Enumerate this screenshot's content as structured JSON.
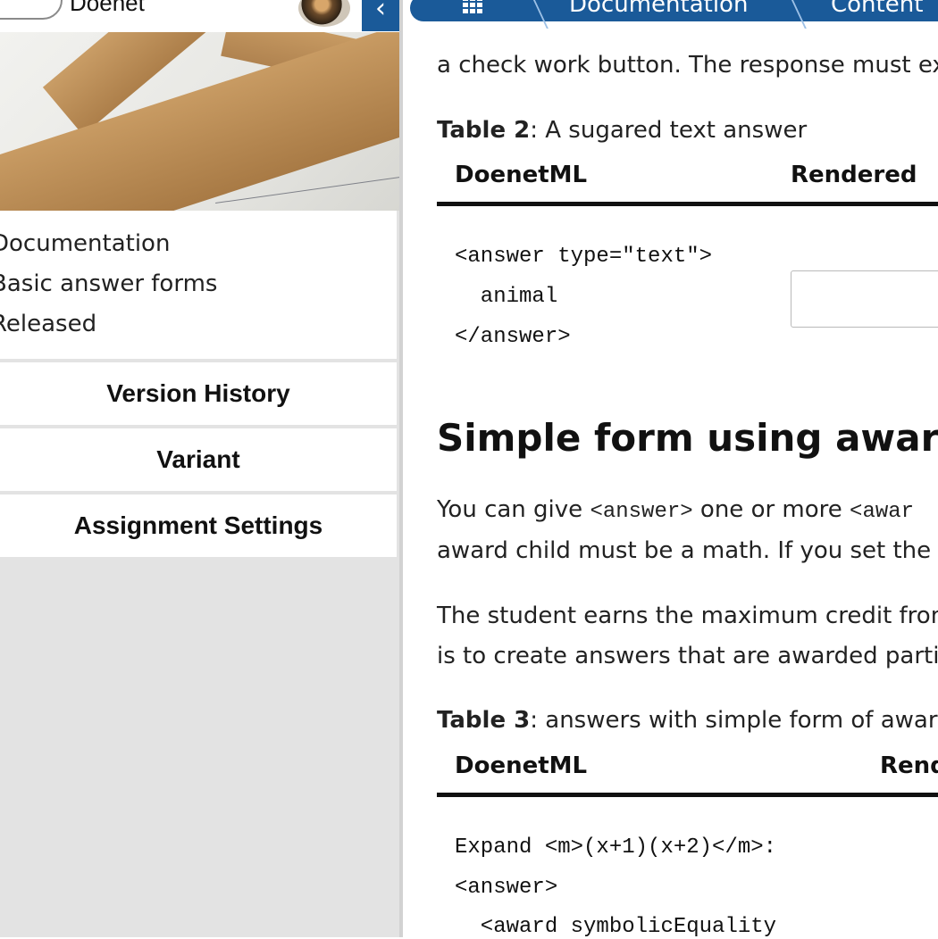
{
  "brand": {
    "name": "Doenet"
  },
  "left_panel": {
    "collapse_glyph": "‹",
    "info_lines": [
      "Documentation",
      "Basic answer forms",
      "Released"
    ],
    "buttons": {
      "version_history": "Version History",
      "variant": "Variant",
      "assignment_settings": "Assignment Settings"
    }
  },
  "breadcrumb": {
    "items": [
      "Documentation",
      "Content"
    ]
  },
  "main": {
    "intro_text": "a check work button. The response must ex",
    "table2": {
      "caption_label": "Table 2",
      "caption_text": ": A sugared text answer",
      "headers": [
        "DoenetML",
        "Rendered"
      ],
      "code_lines": [
        "<answer type=\"text\">",
        "  animal",
        "</answer>"
      ]
    },
    "section_title": "Simple form using award",
    "para1_line1_a": "You can give ",
    "para1_line1_code1": "<answer>",
    "para1_line1_b": " one or more ",
    "para1_line1_code2": "<awar",
    "para1_line2": "award child must be a math. If you set the a",
    "para2_line1": "The student earns the maximum credit fron",
    "para2_line2": "is to create answers that are awarded partia",
    "table3": {
      "caption_label": "Table 3",
      "caption_text": ": answers with simple form of award",
      "headers": [
        "DoenetML",
        "Rend"
      ],
      "code_lines": [
        "Expand <m>(x+1)(x+2)</m>:",
        "<answer>",
        "  <award symbolicEquality"
      ]
    }
  }
}
